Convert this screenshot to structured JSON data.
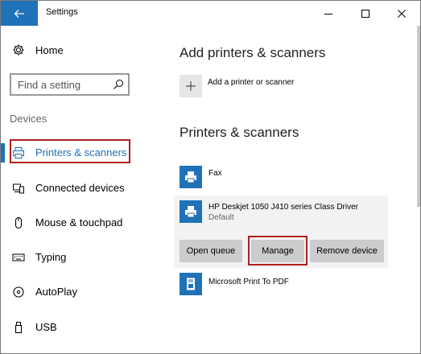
{
  "window": {
    "title": "Settings",
    "controls": {
      "minimize": "minimize",
      "maximize": "maximize",
      "close": "close"
    }
  },
  "sidebar": {
    "home_label": "Home",
    "search": {
      "placeholder": "Find a setting"
    },
    "section_label": "Devices",
    "items": [
      {
        "label": "Printers & scanners",
        "icon": "printer-icon",
        "selected": true
      },
      {
        "label": "Connected devices",
        "icon": "connected-devices-icon"
      },
      {
        "label": "Mouse & touchpad",
        "icon": "mouse-icon"
      },
      {
        "label": "Typing",
        "icon": "keyboard-icon"
      },
      {
        "label": "AutoPlay",
        "icon": "autoplay-icon"
      },
      {
        "label": "USB",
        "icon": "usb-icon"
      }
    ]
  },
  "main": {
    "add_heading": "Add printers & scanners",
    "add_label": "Add a printer or scanner",
    "printers_heading": "Printers & scanners",
    "printers": [
      {
        "name": "Fax",
        "status": ""
      },
      {
        "name": "HP Deskjet 1050 J410 series Class Driver",
        "status": "Default"
      },
      {
        "name": "Microsoft Print To PDF",
        "status": ""
      }
    ],
    "actions": {
      "open_queue": "Open queue",
      "manage": "Manage",
      "remove_device": "Remove device"
    }
  },
  "colors": {
    "accent": "#1f71b8",
    "highlight": "#b11d22",
    "button_bg": "#cccccc",
    "selected_bg": "#f2f2f2"
  }
}
